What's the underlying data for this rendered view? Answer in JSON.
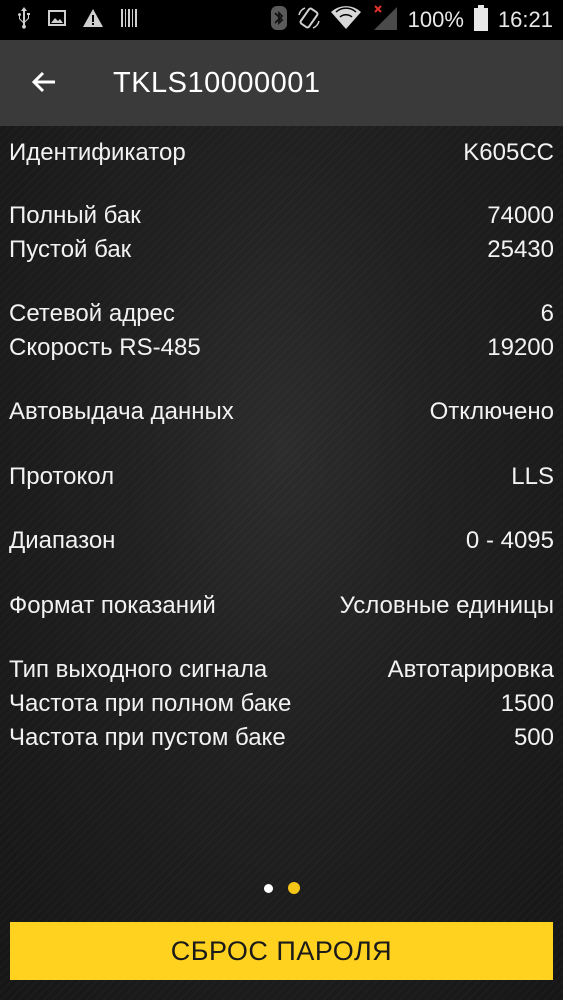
{
  "status_bar": {
    "left_icons": [
      "usb-icon",
      "image-icon",
      "warning-icon",
      "barcode-icon"
    ],
    "right_icons": [
      "bluetooth-icon",
      "screen-rotation-icon",
      "wifi-icon",
      "cellular-signal-icon"
    ],
    "battery_percent": "100%",
    "time": "16:21"
  },
  "app_bar": {
    "title": "TKLS10000001",
    "back_icon": "arrow-left-icon"
  },
  "rows": [
    {
      "label": "Идентификатор",
      "value": "K605CC"
    },
    {
      "label": "Полный бак",
      "value": "74000"
    },
    {
      "label": "Пустой бак",
      "value": "25430"
    },
    {
      "label": "Сетевой адрес",
      "value": "6"
    },
    {
      "label": "Скорость RS-485",
      "value": "19200"
    },
    {
      "label": "Автовыдача данных",
      "value": "Отключено"
    },
    {
      "label": "Протокол",
      "value": "LLS"
    },
    {
      "label": "Диапазон",
      "value": "0 - 4095"
    },
    {
      "label": "Формат показаний",
      "value": "Условные единицы"
    },
    {
      "label": "Тип выходного сигнала",
      "value": "Автотарировка"
    },
    {
      "label": "Частота при полном баке",
      "value": "1500"
    },
    {
      "label": "Частота при пустом баке",
      "value": "500"
    }
  ],
  "pager": {
    "count": 2,
    "active_index": 1
  },
  "colors": {
    "accent": "#ffd21f",
    "app_bar": "#3a3a3a",
    "status_bar": "#000000",
    "background": "#1f1f1f"
  },
  "reset_button": {
    "label": "СБРОС ПАРОЛЯ"
  }
}
